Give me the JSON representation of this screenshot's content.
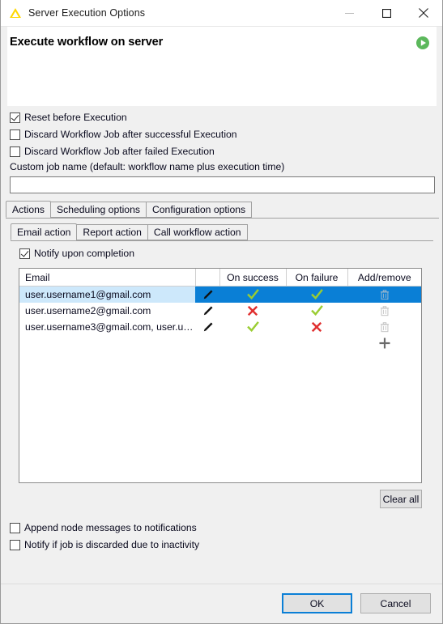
{
  "window": {
    "title": "Server Execution Options",
    "app_icon": "knime-triangle-icon",
    "minimize_label": "Minimize",
    "maximize_label": "Maximize",
    "close_label": "Close"
  },
  "header": {
    "title": "Execute workflow on server",
    "run_icon": "green-play-icon"
  },
  "options": [
    {
      "label": "Reset before Execution",
      "checked": true
    },
    {
      "label": "Discard Workflow Job after successful Execution",
      "checked": false
    },
    {
      "label": "Discard Workflow Job after failed Execution",
      "checked": false
    }
  ],
  "job_name": {
    "label": "Custom job name (default: workflow name plus execution time)",
    "value": "",
    "placeholder": ""
  },
  "outer_tabs": [
    {
      "label": "Actions",
      "active": true
    },
    {
      "label": "Scheduling options",
      "active": false
    },
    {
      "label": "Configuration options",
      "active": false
    }
  ],
  "inner_tabs": [
    {
      "label": "Email action",
      "active": true
    },
    {
      "label": "Report action",
      "active": false
    },
    {
      "label": "Call workflow action",
      "active": false
    }
  ],
  "notify": {
    "label": "Notify upon completion",
    "checked": true
  },
  "table": {
    "columns": [
      "Email",
      "",
      "On success",
      "On failure",
      "Add/remove"
    ],
    "rows": [
      {
        "email": "user.username1@gmail.com",
        "edit_icon": "pencil-icon",
        "on_success": "check",
        "on_failure": "check",
        "remove_icon": "trash-icon",
        "selected": true
      },
      {
        "email": "user.username2@gmail.com",
        "edit_icon": "pencil-icon",
        "on_success": "cross",
        "on_failure": "check",
        "remove_icon": "trash-icon",
        "selected": false
      },
      {
        "email": "user.username3@gmail.com, user.us...",
        "edit_icon": "pencil-icon",
        "on_success": "check",
        "on_failure": "cross",
        "remove_icon": "trash-icon",
        "selected": false
      }
    ],
    "add_icon": "plus-icon"
  },
  "clear_all_label": "Clear all",
  "bottom_options": [
    {
      "label": "Append node messages to notifications",
      "checked": false
    },
    {
      "label": "Notify if job is discarded due to inactivity",
      "checked": false
    }
  ],
  "buttons": {
    "ok": "OK",
    "cancel": "Cancel"
  },
  "colors": {
    "selection_blue": "#0a7fd6",
    "selection_light": "#cde8fb",
    "check_green": "#9acd32",
    "cross_red": "#e03030",
    "run_green": "#5cb85c",
    "logo_yellow": "#ffd700",
    "panel_gray": "#f0f0f0"
  }
}
